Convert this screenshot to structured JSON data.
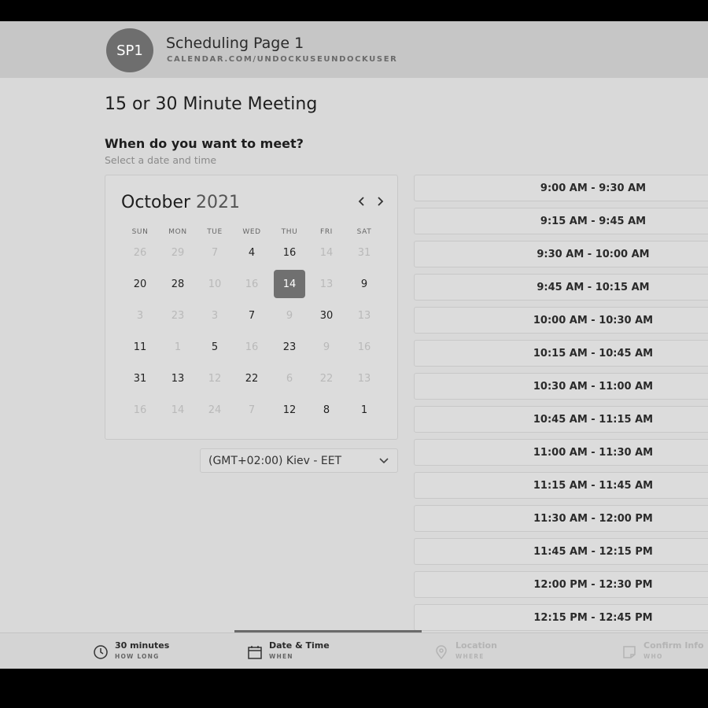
{
  "header": {
    "avatar_initials": "SP1",
    "page_name": "Scheduling Page 1",
    "page_url": "CALENDAR.COM/UNDOCKUSEUNDOCKUSER"
  },
  "meeting": {
    "title": "15 or 30 Minute Meeting",
    "question": "When do you want to meet?",
    "subtitle": "Select a date and time"
  },
  "calendar": {
    "month": "October",
    "year": "2021",
    "prev_icon": "chevron-left-icon",
    "next_icon": "chevron-right-icon",
    "weekdays": [
      "SUN",
      "MON",
      "TUE",
      "WED",
      "THU",
      "FRI",
      "SAT"
    ],
    "weeks": [
      [
        {
          "d": "26",
          "muted": true
        },
        {
          "d": "29",
          "muted": true
        },
        {
          "d": "7",
          "muted": true
        },
        {
          "d": "4",
          "muted": false
        },
        {
          "d": "16",
          "muted": false
        },
        {
          "d": "14",
          "muted": true
        },
        {
          "d": "31",
          "muted": true
        }
      ],
      [
        {
          "d": "20",
          "muted": false
        },
        {
          "d": "28",
          "muted": false
        },
        {
          "d": "10",
          "muted": true
        },
        {
          "d": "16",
          "muted": true
        },
        {
          "d": "14",
          "muted": false,
          "selected": true
        },
        {
          "d": "13",
          "muted": true
        },
        {
          "d": "9",
          "muted": false
        }
      ],
      [
        {
          "d": "3",
          "muted": true
        },
        {
          "d": "23",
          "muted": true
        },
        {
          "d": "3",
          "muted": true
        },
        {
          "d": "7",
          "muted": false
        },
        {
          "d": "9",
          "muted": true
        },
        {
          "d": "30",
          "muted": false
        },
        {
          "d": "13",
          "muted": true
        }
      ],
      [
        {
          "d": "11",
          "muted": false
        },
        {
          "d": "1",
          "muted": true
        },
        {
          "d": "5",
          "muted": false
        },
        {
          "d": "16",
          "muted": true
        },
        {
          "d": "23",
          "muted": false
        },
        {
          "d": "9",
          "muted": true
        },
        {
          "d": "16",
          "muted": true
        }
      ],
      [
        {
          "d": "31",
          "muted": false
        },
        {
          "d": "13",
          "muted": false
        },
        {
          "d": "12",
          "muted": true
        },
        {
          "d": "22",
          "muted": false
        },
        {
          "d": "6",
          "muted": true
        },
        {
          "d": "22",
          "muted": true
        },
        {
          "d": "13",
          "muted": true
        }
      ],
      [
        {
          "d": "16",
          "muted": true
        },
        {
          "d": "14",
          "muted": true
        },
        {
          "d": "24",
          "muted": true
        },
        {
          "d": "7",
          "muted": true
        },
        {
          "d": "12",
          "muted": false
        },
        {
          "d": "8",
          "muted": false
        },
        {
          "d": "1",
          "muted": false
        }
      ]
    ]
  },
  "timezone": {
    "value": "(GMT+02:00) Kiev - EET",
    "icon": "chevron-down-icon"
  },
  "time_slots": [
    "9:00 AM - 9:30 AM",
    "9:15 AM - 9:45 AM",
    "9:30 AM - 10:00 AM",
    "9:45 AM - 10:15 AM",
    "10:00 AM - 10:30 AM",
    "10:15 AM - 10:45 AM",
    "10:30 AM - 11:00 AM",
    "10:45 AM - 11:15 AM",
    "11:00 AM - 11:30 AM",
    "11:15 AM - 11:45 AM",
    "11:30 AM - 12:00 PM",
    "11:45 AM - 12:15 PM",
    "12:00 PM - 12:30 PM",
    "12:15 PM - 12:45 PM"
  ],
  "steps": [
    {
      "label": "30 minutes",
      "sub": "HOW LONG",
      "icon": "clock-icon",
      "active": false,
      "disabled": false
    },
    {
      "label": "Date & Time",
      "sub": "WHEN",
      "icon": "calendar-icon",
      "active": true,
      "disabled": false
    },
    {
      "label": "Location",
      "sub": "WHERE",
      "icon": "map-pin-icon",
      "active": false,
      "disabled": true
    },
    {
      "label": "Confirm Info",
      "sub": "WHO",
      "icon": "note-icon",
      "active": false,
      "disabled": true
    }
  ],
  "colors": {
    "header_bg": "#c6c6c6",
    "page_bg": "#d9d9d9",
    "selected_day": "#707070",
    "avatar_bg": "#6e6e6e"
  }
}
